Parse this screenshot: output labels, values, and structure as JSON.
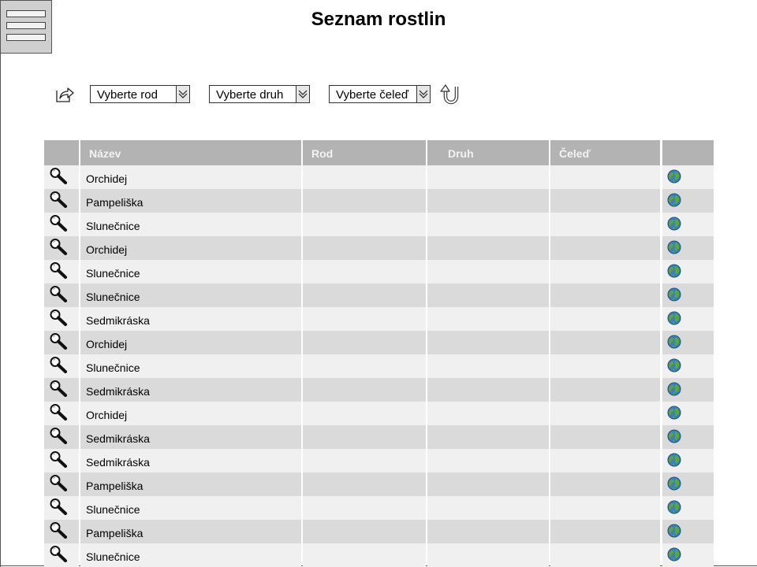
{
  "header": {
    "title": "Seznam rostlin",
    "menu_icon": "hamburger-menu-icon"
  },
  "toolbar": {
    "export_icon": "export-share-icon",
    "reset_icon": "undo-reset-icon",
    "filters": [
      {
        "value": "Vyberte rod"
      },
      {
        "value": "Vyberte druh"
      },
      {
        "value": "Vyberte čeleď"
      }
    ]
  },
  "table": {
    "columns": [
      "",
      "Název",
      "Rod",
      "Druh",
      "Čeleď",
      ""
    ],
    "row_action_icon": "magnifier-search-icon",
    "row_link_icon": "globe-icon",
    "rows": [
      {
        "name": "Orchidej",
        "rod": "",
        "druh": "",
        "celed": ""
      },
      {
        "name": "Pampeliška",
        "rod": "",
        "druh": "",
        "celed": ""
      },
      {
        "name": "Slunečnice",
        "rod": "",
        "druh": "",
        "celed": ""
      },
      {
        "name": "Orchidej",
        "rod": "",
        "druh": "",
        "celed": ""
      },
      {
        "name": "Slunečnice",
        "rod": "",
        "druh": "",
        "celed": ""
      },
      {
        "name": "Slunečnice",
        "rod": "",
        "druh": "",
        "celed": ""
      },
      {
        "name": "Sedmikráska",
        "rod": "",
        "druh": "",
        "celed": ""
      },
      {
        "name": "Orchidej",
        "rod": "",
        "druh": "",
        "celed": ""
      },
      {
        "name": "Slunečnice",
        "rod": "",
        "druh": "",
        "celed": ""
      },
      {
        "name": "Sedmikráska",
        "rod": "",
        "druh": "",
        "celed": ""
      },
      {
        "name": "Orchidej",
        "rod": "",
        "druh": "",
        "celed": ""
      },
      {
        "name": "Sedmikráska",
        "rod": "",
        "druh": "",
        "celed": ""
      },
      {
        "name": "Sedmikráska",
        "rod": "",
        "druh": "",
        "celed": ""
      },
      {
        "name": "Pampeliška",
        "rod": "",
        "druh": "",
        "celed": ""
      },
      {
        "name": "Slunečnice",
        "rod": "",
        "druh": "",
        "celed": ""
      },
      {
        "name": "Pampeliška",
        "rod": "",
        "druh": "",
        "celed": ""
      },
      {
        "name": "Slunečnice",
        "rod": "",
        "druh": "",
        "celed": ""
      }
    ]
  },
  "colors": {
    "header_bg": "#b3b3b3",
    "header_text": "#f3f3f3",
    "row_light": "#f0f0f0",
    "row_dark": "#dadada",
    "menu_bg": "#cfcfcf"
  }
}
